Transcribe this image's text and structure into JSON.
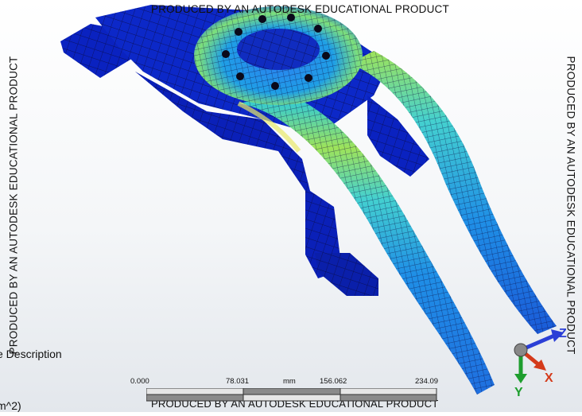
{
  "watermark": {
    "text_top": "PRODUCED BY AN AUTODESK EDUCATIONAL PRODUCT",
    "text_bottom": "PRODUCED BY AN AUTODESK EDUCATIONAL PRODUCT",
    "text_left": "PRODUCED BY AN AUTODESK EDUCATIONAL PRODUCT",
    "text_right": "PRODUCED BY AN AUTODESK EDUCATIONAL PRODUCT"
  },
  "legend": {
    "description_label": "e Description",
    "line2": ")",
    "line3": "m^2)"
  },
  "scale_bar": {
    "ticks": [
      "0.000",
      "78.031",
      "156.062",
      "234.09"
    ],
    "unit": "mm"
  },
  "triad": {
    "x_label": "X",
    "y_label": "Y",
    "z_label": "Z",
    "x_color": "#d43a1a",
    "y_color": "#1e9e2e",
    "z_color": "#2b3fd6"
  },
  "contour_colors": {
    "low": "#0a1fb8",
    "mid_low": "#1f6fe0",
    "mid": "#22c6e6",
    "mid_high": "#7ee07a",
    "high": "#e8e86a"
  }
}
